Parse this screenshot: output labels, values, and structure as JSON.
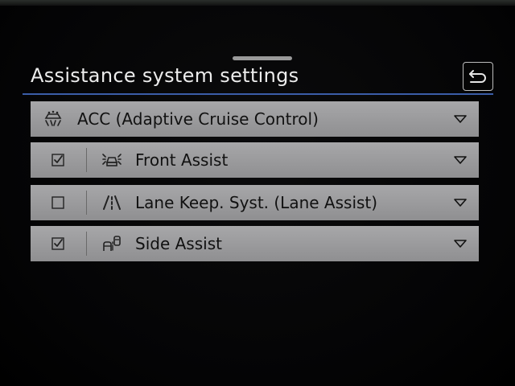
{
  "header": {
    "title": "Assistance system settings",
    "back_icon": "back-arrow-icon"
  },
  "colors": {
    "accent_rule": "#3b5da8",
    "row_background": "#9c9c9e",
    "background": "#000000"
  },
  "rows": [
    {
      "label": "ACC (Adaptive Cruise Control)",
      "icon": "adaptive-cruise-control-icon",
      "has_checkbox": false,
      "expandable": true
    },
    {
      "label": "Front Assist",
      "icon": "front-assist-icon",
      "has_checkbox": true,
      "checked": true,
      "expandable": true
    },
    {
      "label": "Lane Keep. Syst. (Lane Assist)",
      "icon": "lane-assist-icon",
      "has_checkbox": true,
      "checked": false,
      "expandable": true
    },
    {
      "label": "Side Assist",
      "icon": "side-assist-icon",
      "has_checkbox": true,
      "checked": true,
      "expandable": true
    }
  ]
}
